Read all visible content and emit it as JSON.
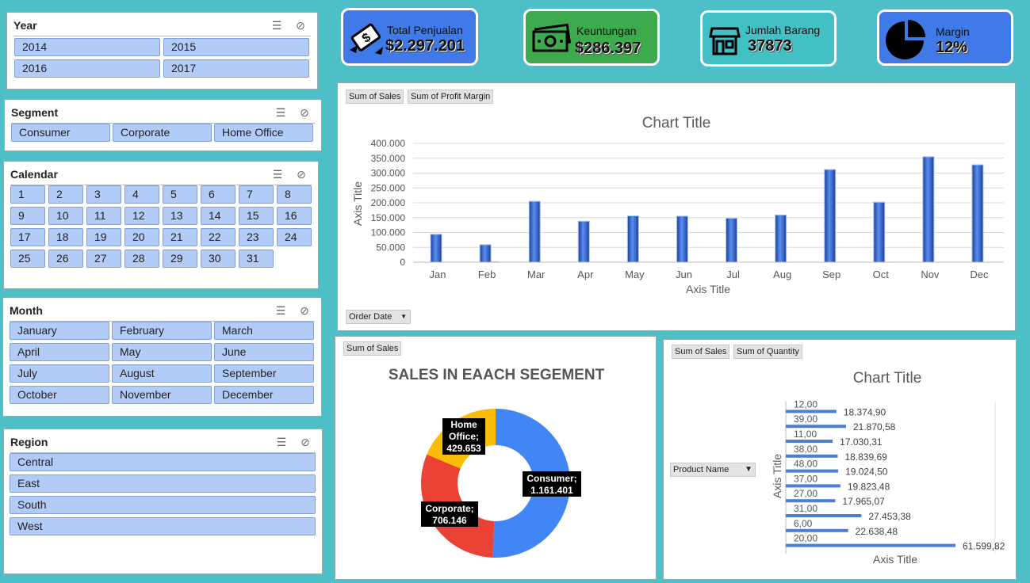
{
  "slicers": {
    "year": {
      "title": "Year",
      "items": [
        "2014",
        "2015",
        "2016",
        "2017"
      ]
    },
    "segment": {
      "title": "Segment",
      "items": [
        "Consumer",
        "Corporate",
        "Home Office"
      ]
    },
    "calendar": {
      "title": "Calendar",
      "items": [
        "1",
        "2",
        "3",
        "4",
        "5",
        "6",
        "7",
        "8",
        "9",
        "10",
        "11",
        "12",
        "13",
        "14",
        "15",
        "16",
        "17",
        "18",
        "19",
        "20",
        "21",
        "22",
        "23",
        "24",
        "25",
        "26",
        "27",
        "28",
        "29",
        "30",
        "31"
      ]
    },
    "month": {
      "title": "Month",
      "items": [
        "January",
        "February",
        "March",
        "April",
        "May",
        "June",
        "July",
        "August",
        "September",
        "October",
        "November",
        "December"
      ]
    },
    "region": {
      "title": "Region",
      "items": [
        "Central",
        "East",
        "South",
        "West"
      ]
    }
  },
  "kpis": {
    "sales": {
      "label": "Total Penjualan",
      "value": "$2.297.201",
      "icon": "money-wings-icon",
      "color": "#3f7ae8"
    },
    "profit": {
      "label": "Keuntungan",
      "value": "$286.397",
      "icon": "banknote-icon",
      "color": "#3eaa4e"
    },
    "items": {
      "label": "Jumlah Barang",
      "value": "37873",
      "icon": "store-icon",
      "color": "#43c0c4"
    },
    "margin": {
      "label": "Margin",
      "value": "12%",
      "icon": "pie-chart-icon",
      "color": "#3f7ae8"
    }
  },
  "monthly_chart": {
    "field_buttons": [
      "Sum of Sales",
      "Sum of Profit Margin"
    ],
    "axis_field_button": "Order Date",
    "y_tick_labels": [
      "400.000",
      "350.000",
      "300.000",
      "250.000",
      "200.000",
      "150.000",
      "100.000",
      "50.000",
      "0"
    ]
  },
  "segment_chart": {
    "field_button": "Sum of Sales",
    "slice_labels": [
      {
        "name": "Consumer;",
        "value": "1.161.401"
      },
      {
        "name": "Corporate;",
        "value": "706.146"
      },
      {
        "name": "Home Office;",
        "value": "429.653"
      }
    ]
  },
  "product_chart": {
    "field_buttons": [
      "Sum of Sales",
      "Sum of Quantity"
    ],
    "row_field_button": "Product Name",
    "data_labels": [
      "18.374,90",
      "21.870,58",
      "17.030,31",
      "18.839,69",
      "19.024,50",
      "19.823,48",
      "17.965,07",
      "27.453,38",
      "22.638,48",
      "61.599,82"
    ]
  },
  "chart_data": [
    {
      "type": "bar",
      "title": "Chart Title",
      "xlabel": "Axis Title",
      "ylabel": "Axis Title",
      "ylim": [
        0,
        400000
      ],
      "grid": true,
      "categories": [
        "Jan",
        "Feb",
        "Mar",
        "Apr",
        "May",
        "Jun",
        "Jul",
        "Aug",
        "Sep",
        "Oct",
        "Nov",
        "Dec"
      ],
      "series": [
        {
          "values": [
            94000,
            59000,
            205000,
            138000,
            156000,
            155000,
            148000,
            159000,
            312000,
            202000,
            355000,
            328000
          ],
          "color": "#2e63d6"
        },
        {
          "values": [
            0,
            2000,
            0,
            0,
            0,
            0,
            0,
            0,
            0,
            1500,
            0,
            0
          ],
          "color": "#e03a2f"
        }
      ]
    },
    {
      "type": "pie",
      "title": "SALES IN EAACH SEGEMENT",
      "categories": [
        "Consumer",
        "Corporate",
        "Home Office"
      ],
      "values": [
        1161401,
        706146,
        429653
      ],
      "colors": [
        "#4285f4",
        "#ea4335",
        "#fbbc05"
      ]
    },
    {
      "type": "bar",
      "title": "Chart Title",
      "xlabel": "Axis Title",
      "ylabel": "Axis Title",
      "categories": [
        "12,00",
        "39,00",
        "11,00",
        "38,00",
        "48,00",
        "37,00",
        "27,00",
        "31,00",
        "6,00",
        "20,00"
      ],
      "series": [
        {
          "values": [
            18374.9,
            21870.58,
            17030.31,
            18839.69,
            19024.5,
            19823.48,
            17965.07,
            27453.38,
            22638.48,
            61599.82
          ],
          "color": "#4a7fd4"
        }
      ]
    }
  ]
}
